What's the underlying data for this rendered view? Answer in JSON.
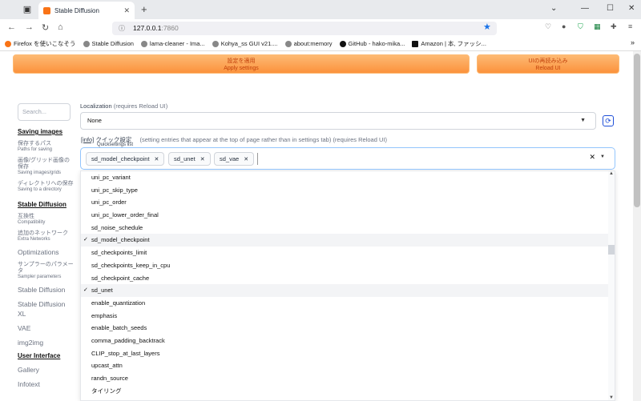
{
  "browser": {
    "tab_title": "Stable Diffusion",
    "url_host": "127.0.0.1",
    "url_port": ":7860",
    "bookmarks": [
      "Firefox を使いこなそう",
      "Stable Diffusion",
      "lama-cleaner - Ima...",
      "Kohya_ss GUI v21....",
      "about:memory",
      "GitHub - hako-mika...",
      "Amazon | 本, ファッシ..."
    ]
  },
  "buttons": {
    "apply_ja": "設定を適用",
    "apply_en": "Apply settings",
    "reload_ja": "UIの再読み込み",
    "reload_en": "Reload UI"
  },
  "sidebar": {
    "search_placeholder": "Search...",
    "saving_images": "Saving images",
    "items_saving": [
      {
        "ja": "保存するパス",
        "en": "Paths for saving"
      },
      {
        "ja": "画像/グリッド画像の保存",
        "en": "Saving images/grids"
      },
      {
        "ja": "ディレクトリへの保存",
        "en": "Saving to a directory"
      }
    ],
    "stable_diffusion": "Stable Diffusion",
    "items_sd": [
      {
        "ja": "互換性",
        "en": "Compatibility"
      },
      {
        "ja": "追加のネットワーク",
        "en": "Extra Networks"
      }
    ],
    "optimizations": "Optimizations",
    "sampler": {
      "ja": "サンプラーのパラメータ",
      "en": "Sampler parameters"
    },
    "stable_diffusion_plain": "Stable Diffusion",
    "sdxl": "Stable Diffusion XL",
    "vae": "VAE",
    "img2img": "img2img",
    "user_interface": "User Interface",
    "gallery": "Gallery",
    "infotext": "Infotext"
  },
  "localization": {
    "label": "Localization",
    "requires": "(requires Reload UI)",
    "value": "None"
  },
  "quicksettings": {
    "info": "[info]",
    "label_ja": "クイック設定",
    "label_en": "Quicksettings list",
    "desc": "(setting entries that appear at the top of page rather than in settings tab) (requires Reload UI)",
    "chips": [
      "sd_model_checkpoint",
      "sd_unet",
      "sd_vae"
    ]
  },
  "dropdown": {
    "items": [
      {
        "label": "uni_pc_variant",
        "checked": false
      },
      {
        "label": "uni_pc_skip_type",
        "checked": false
      },
      {
        "label": "uni_pc_order",
        "checked": false
      },
      {
        "label": "uni_pc_lower_order_final",
        "checked": false
      },
      {
        "label": "sd_noise_schedule",
        "checked": false
      },
      {
        "label": "sd_model_checkpoint",
        "checked": true
      },
      {
        "label": "sd_checkpoints_limit",
        "checked": false
      },
      {
        "label": "sd_checkpoints_keep_in_cpu",
        "checked": false
      },
      {
        "label": "sd_checkpoint_cache",
        "checked": false
      },
      {
        "label": "sd_unet",
        "checked": true
      },
      {
        "label": "enable_quantization",
        "checked": false
      },
      {
        "label": "emphasis",
        "checked": false
      },
      {
        "label": "enable_batch_seeds",
        "checked": false
      },
      {
        "label": "comma_padding_backtrack",
        "checked": false
      },
      {
        "label": "CLIP_stop_at_last_layers",
        "checked": false
      },
      {
        "label": "upcast_attn",
        "checked": false
      },
      {
        "label": "randn_source",
        "checked": false
      },
      {
        "label": "タイリング",
        "checked": false
      }
    ]
  }
}
